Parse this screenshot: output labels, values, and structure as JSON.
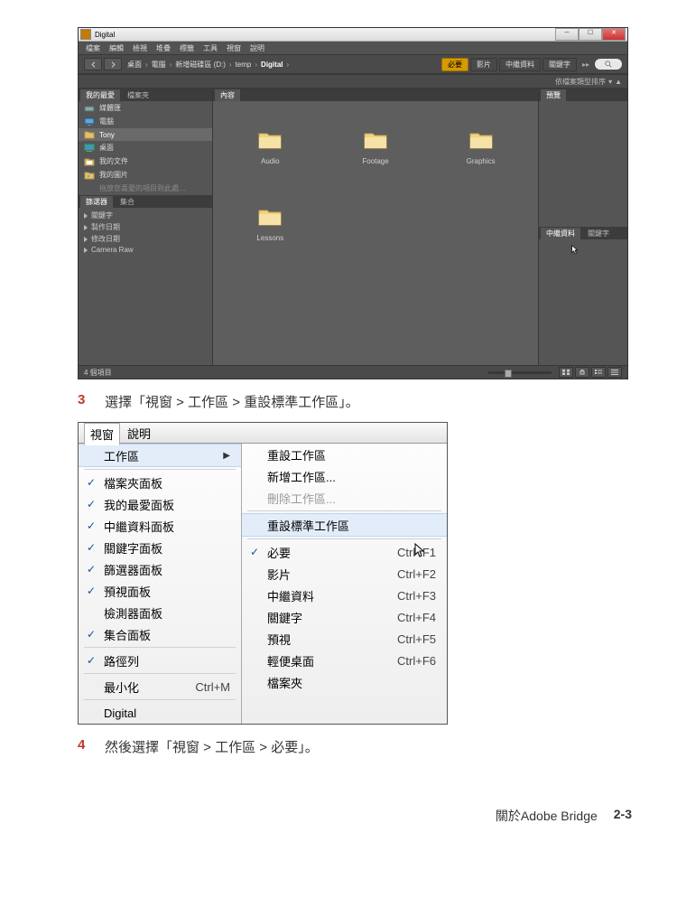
{
  "bridge": {
    "title": "Digital",
    "menu": [
      "檔案",
      "編輯",
      "檢視",
      "堆疊",
      "標籤",
      "工具",
      "視窗",
      "說明"
    ],
    "breadcrumbs": [
      "桌面",
      "電腦",
      "新增磁碟區 (D:)",
      "temp",
      "Digital"
    ],
    "workspace_pills": {
      "active": "必要",
      "others": [
        "影片",
        "中繼資料",
        "關鍵字"
      ]
    },
    "sort_label": "依檔案類型排序",
    "left_tabs_top": {
      "active": "我的最愛",
      "other": "檔案夾"
    },
    "favorites_items": [
      {
        "icon": "drive",
        "label": "媒體匯"
      },
      {
        "icon": "computer",
        "label": "電腦"
      },
      {
        "icon": "folder",
        "label": "Tony"
      },
      {
        "icon": "desktop",
        "label": "桌面"
      },
      {
        "icon": "documents",
        "label": "我的文件"
      },
      {
        "icon": "pictures",
        "label": "我的圖片"
      }
    ],
    "favorites_hint": "拖放您喜愛的項目到此處…",
    "left_tabs_bottom": {
      "active": "篩選器",
      "other": "集合"
    },
    "filters": [
      "關鍵字",
      "製作日期",
      "修改日期",
      "Camera Raw"
    ],
    "content_tab": "內容",
    "content_items": [
      "Audio",
      "Footage",
      "Graphics",
      "Lessons"
    ],
    "right_tab_preview": "預覽",
    "right_tabs_bottom": {
      "active": "中繼資料",
      "other": "關鍵字"
    },
    "status": "4 個項目"
  },
  "step3": {
    "num": "3",
    "text": "選擇「視窗 > 工作區 > 重設標準工作區」。"
  },
  "menu_mock": {
    "top_menu": {
      "active": "視窗",
      "other": "說明"
    },
    "left": [
      {
        "type": "item",
        "checked": false,
        "label": "工作區",
        "accel": "",
        "arrow": true,
        "sel": true
      },
      {
        "type": "sep"
      },
      {
        "type": "item",
        "checked": true,
        "label": "檔案夾面板"
      },
      {
        "type": "item",
        "checked": true,
        "label": "我的最愛面板"
      },
      {
        "type": "item",
        "checked": true,
        "label": "中繼資料面板"
      },
      {
        "type": "item",
        "checked": true,
        "label": "關鍵字面板"
      },
      {
        "type": "item",
        "checked": true,
        "label": "篩選器面板"
      },
      {
        "type": "item",
        "checked": true,
        "label": "預視面板"
      },
      {
        "type": "item",
        "checked": false,
        "label": "檢測器面板"
      },
      {
        "type": "item",
        "checked": true,
        "label": "集合面板"
      },
      {
        "type": "sep"
      },
      {
        "type": "item",
        "checked": true,
        "label": "路徑列"
      },
      {
        "type": "sep"
      },
      {
        "type": "item",
        "checked": false,
        "label": "最小化",
        "accel": "Ctrl+M"
      },
      {
        "type": "sep"
      },
      {
        "type": "item",
        "checked": false,
        "label": "Digital"
      }
    ],
    "right": [
      {
        "type": "item",
        "label": "重設工作區"
      },
      {
        "type": "item",
        "label": "新增工作區..."
      },
      {
        "type": "item",
        "label": "刪除工作區...",
        "disabled": true
      },
      {
        "type": "sep"
      },
      {
        "type": "item",
        "label": "重設標準工作區",
        "sel": true
      },
      {
        "type": "sep"
      },
      {
        "type": "item",
        "checked": true,
        "label": "必要",
        "accel": "Ctrl+F1"
      },
      {
        "type": "item",
        "label": "影片",
        "accel": "Ctrl+F2"
      },
      {
        "type": "item",
        "label": "中繼資料",
        "accel": "Ctrl+F3"
      },
      {
        "type": "item",
        "label": "關鍵字",
        "accel": "Ctrl+F4"
      },
      {
        "type": "item",
        "label": "預視",
        "accel": "Ctrl+F5"
      },
      {
        "type": "item",
        "label": "輕便桌面",
        "accel": "Ctrl+F6"
      },
      {
        "type": "item",
        "label": "檔案夾"
      }
    ]
  },
  "step4": {
    "num": "4",
    "text": "然後選擇「視窗 > 工作區 > 必要」。"
  },
  "footer": {
    "chapter": "關於Adobe Bridge",
    "page": "2-3"
  }
}
